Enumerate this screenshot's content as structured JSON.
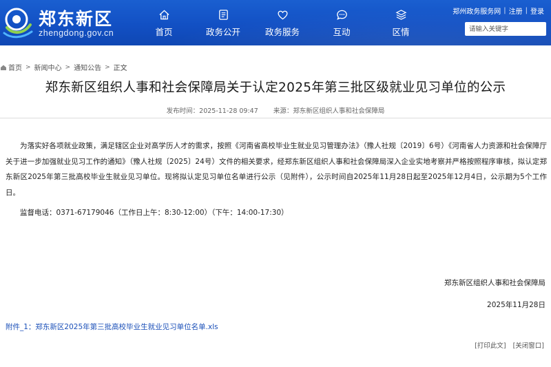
{
  "header": {
    "site_name": "郑东新区",
    "site_domain": "zhengdong.gov.cn",
    "nav": [
      {
        "label": "首页",
        "icon": "home-icon"
      },
      {
        "label": "政务公开",
        "icon": "document-icon"
      },
      {
        "label": "政务服务",
        "icon": "heart-icon"
      },
      {
        "label": "互动",
        "icon": "chat-icon"
      },
      {
        "label": "区情",
        "icon": "layers-icon"
      }
    ],
    "top_links": {
      "service_link": "郑州政务服务网",
      "register": "注册",
      "login": "登录"
    },
    "search_placeholder": "请输入关键字"
  },
  "breadcrumb": {
    "home": "首页",
    "news": "新闻中心",
    "notices": "通知公告",
    "current": "正文"
  },
  "article": {
    "title": "郑东新区组织人事和社会保障局关于认定2025年第三批区级就业见习单位的公示",
    "publish_time": "发布时间：2025-11-28 09:47",
    "source": "来源：郑东新区组织人事和社会保障局",
    "body": "为落实好各项就业政策，满足辖区企业对高学历人才的需求，按照《河南省高校毕业生就业见习管理办法》（豫人社规〔2019〕6号）《河南省人力资源和社会保障厅关于进一步加强就业见习工作的通知》（豫人社规〔2025〕24号）文件的相关要求，经郑东新区组织人事和社会保障局深入企业实地考察并严格按照程序审核，拟认定郑东新区2025年第三批高校毕业生就业见习单位。现将拟认定见习单位名单进行公示（见附件），公示时间自2025年11月28日起至2025年12月4日，公示期为5个工作日。",
    "phone": "监督电话：0371-67179046（工作日上午：8:30-12:00）（下午：14:00-17:30）",
    "signature": "郑东新区组织人事和社会保障局",
    "date": "2025年11月28日",
    "attachment": "附件_1：郑东新区2025年第三批高校毕业生就业见习单位名单.xls",
    "print": "[打印此文]",
    "close": "[关闭窗口]"
  }
}
